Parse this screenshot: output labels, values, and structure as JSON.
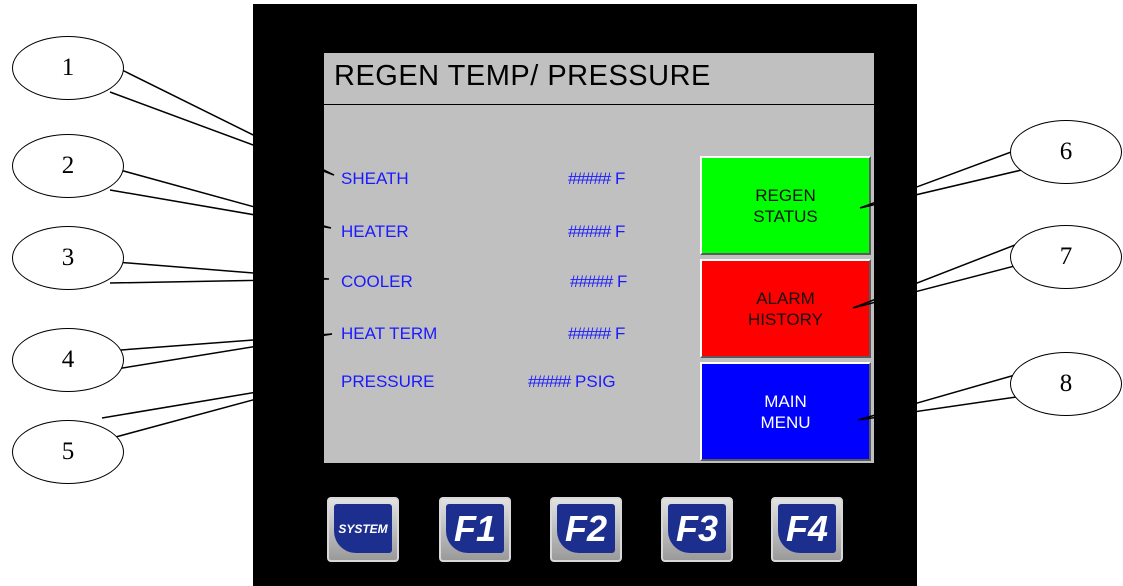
{
  "screen": {
    "title": "REGEN TEMP/ PRESSURE",
    "readings": [
      {
        "label": "SHEATH",
        "value": "#####",
        "unit": "F"
      },
      {
        "label": "HEATER",
        "value": "#####",
        "unit": "F"
      },
      {
        "label": "COOLER",
        "value": "#####",
        "unit": "F"
      },
      {
        "label": "HEAT TERM",
        "value": "#####",
        "unit": "F"
      },
      {
        "label": "PRESSURE",
        "value": "#####",
        "unit": "PSIG"
      }
    ],
    "buttons": [
      {
        "line1": "REGEN",
        "line2": "STATUS",
        "color": "#00ff00"
      },
      {
        "line1": "ALARM",
        "line2": "HISTORY",
        "color": "#ff0000"
      },
      {
        "line1": "MAIN",
        "line2": "MENU",
        "color": "#0000ff"
      }
    ],
    "text_color": "#1a1aff"
  },
  "function_keys": [
    "SYSTEM",
    "F1",
    "F2",
    "F3",
    "F4"
  ],
  "callouts": [
    "1",
    "2",
    "3",
    "4",
    "5",
    "6",
    "7",
    "8"
  ]
}
